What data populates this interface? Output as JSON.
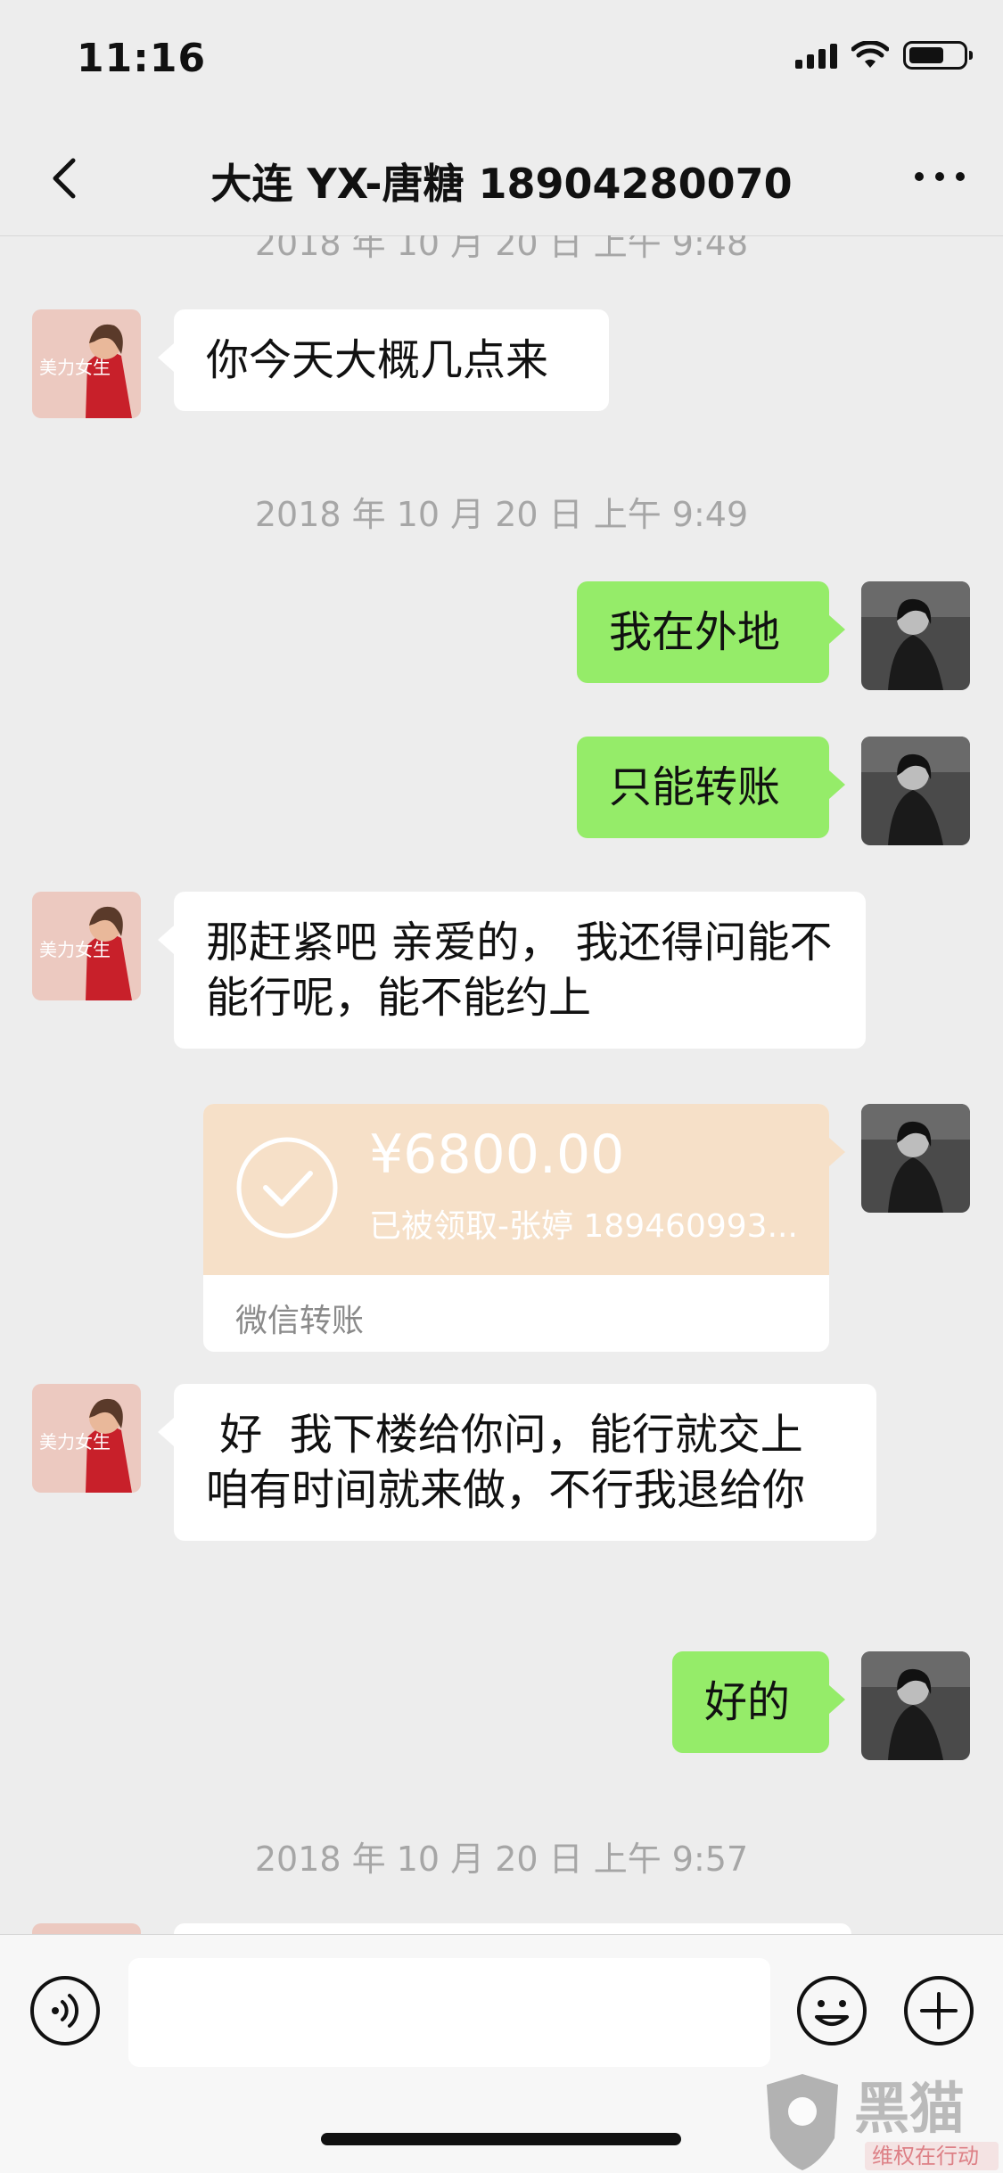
{
  "status": {
    "time": "11:16"
  },
  "nav": {
    "title": "大连 YX-唐糖 18904280070"
  },
  "chat": {
    "timestamps": [
      "2018 年 10 月 20 日 上午 9:48",
      "2018 年 10 月 20 日 上午 9:49",
      "2018 年 10 月 20 日 上午 9:57"
    ],
    "messages": [
      {
        "side": "left",
        "text": "你今天大概几点来"
      },
      {
        "side": "right",
        "text": "我在外地"
      },
      {
        "side": "right",
        "text": "只能转账"
      },
      {
        "side": "left",
        "text": "那赶紧吧 亲爱的， 我还得问能不能行呢，能不能约上"
      },
      {
        "side": "left",
        "text": " 好  我下楼给你问，能行就交上  咱有时间就来做，不行我退给你"
      },
      {
        "side": "right",
        "text": "好的"
      }
    ],
    "transfer": {
      "amount": "¥6800.00",
      "status": "已被领取-张婷 189460993...",
      "label": "微信转账"
    },
    "avatar_left_text": "美力女生"
  },
  "watermark": {
    "text": "黑猫",
    "subtext": "维权在行动"
  },
  "colors": {
    "background": "#ededed",
    "green_bubble": "#95ec69",
    "white_bubble": "#ffffff",
    "transfer_orange": "#f6e0c8",
    "timestamp_gray": "#a6a6a6"
  },
  "icons": [
    "back-chevron-icon",
    "more-dots-icon",
    "voice-icon",
    "emoji-icon",
    "plus-icon",
    "check-icon",
    "wifi-icon",
    "signal-icon",
    "battery-icon"
  ]
}
